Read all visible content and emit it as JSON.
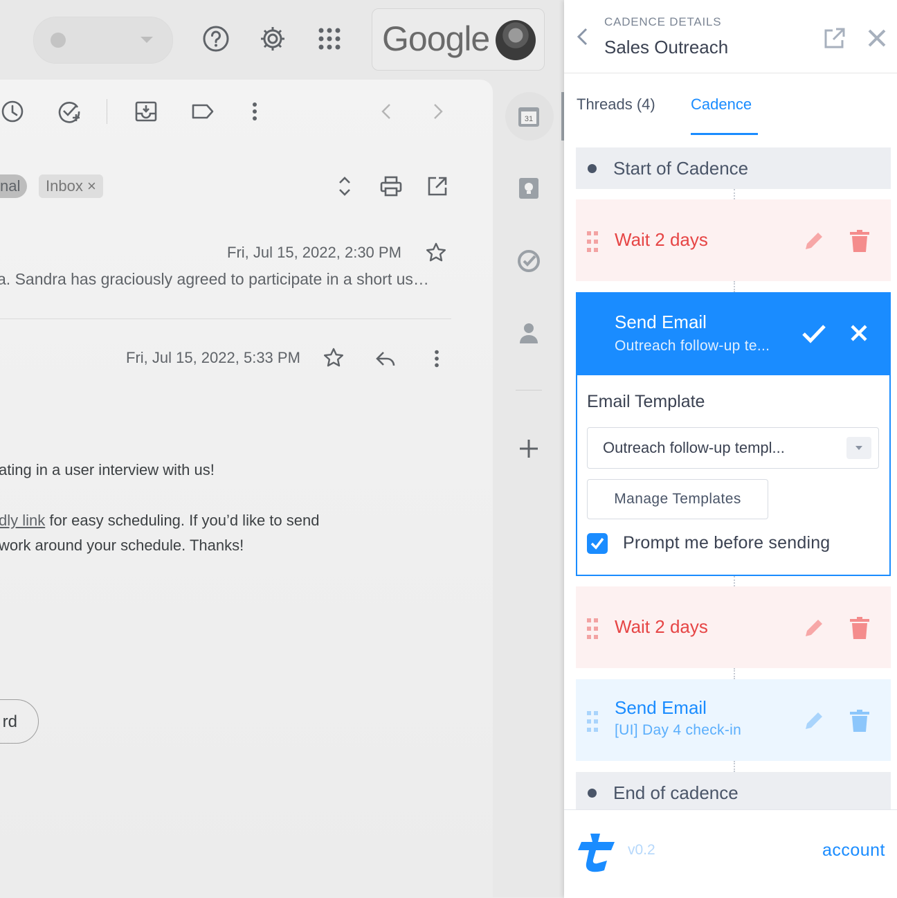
{
  "gmail": {
    "brand": "Google",
    "chips": {
      "label_partial": "nal",
      "inbox": "Inbox",
      "inbox_remove": "×"
    },
    "message1": {
      "date": "Fri, Jul 15, 2022, 2:30 PM",
      "snippet": "a. Sandra has graciously agreed to participate in a short us…"
    },
    "message2": {
      "date": "Fri, Jul 15, 2022, 5:33 PM",
      "body_line1": "ating in a user interview with us!",
      "body_line2_link": "dly link",
      "body_line2_rest": " for easy scheduling. If you’d like to send",
      "body_line3": "work around your schedule. Thanks!"
    },
    "forward_partial": "rd",
    "rail": {
      "calendar_day": "31"
    }
  },
  "panel": {
    "kicker": "CADENCE DETAILS",
    "title": "Sales Outreach",
    "tabs": [
      {
        "label": "Threads (4)",
        "active": false
      },
      {
        "label": "Cadence",
        "active": true
      }
    ],
    "steps": {
      "start": "Start of Cadence",
      "wait1": "Wait 2 days",
      "active_send": {
        "title": "Send Email",
        "subtitle": "Outreach follow-up te...",
        "template_heading": "Email Template",
        "template_value": "Outreach follow-up templ...",
        "manage_label": "Manage Templates",
        "prompt_label": "Prompt me before sending",
        "prompt_checked": true
      },
      "wait2": "Wait 2 days",
      "send2": {
        "title": "Send Email",
        "subtitle": "[UI] Day 4 check-in"
      },
      "end": "End of cadence"
    },
    "footer": {
      "version": "v0.2",
      "account": "account"
    }
  },
  "colors": {
    "accent": "#1a8cff",
    "wait_text": "#e64545",
    "wait_bg": "#fdf1f1",
    "send_bg": "#ecf6ff",
    "cap_bg": "#eceef2"
  }
}
